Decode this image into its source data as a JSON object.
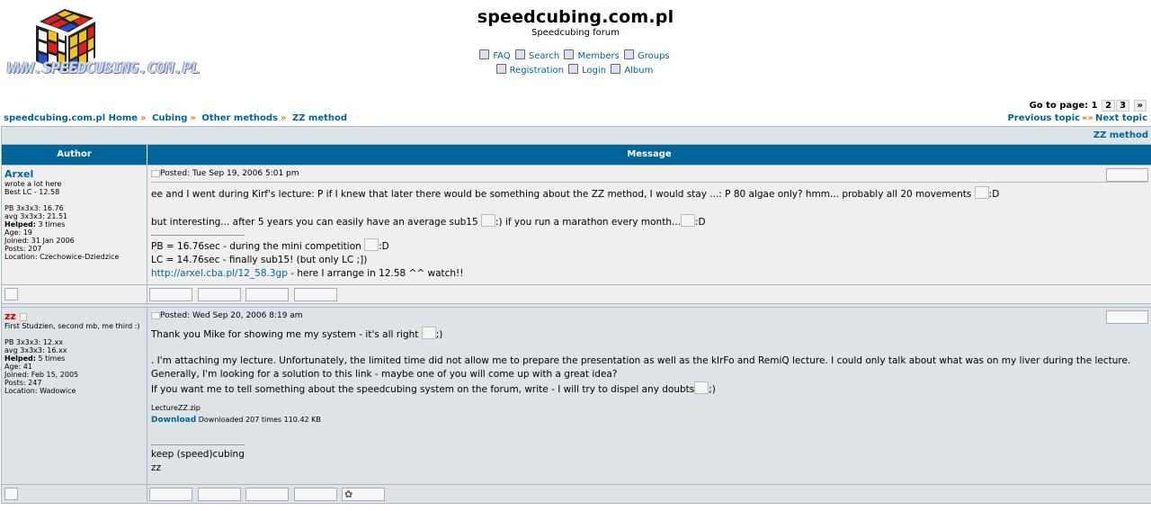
{
  "site": {
    "title": "speedcubing.com.pl",
    "subtitle": "Speedcubing forum",
    "logo_text": "WWW.SPEEDCUBING.COM.PL"
  },
  "nav": {
    "faq": "FAQ",
    "search": "Search",
    "members": "Members",
    "groups": "Groups",
    "registration": "Registration",
    "login": "Login",
    "album": "Album"
  },
  "pager": {
    "label": "Go to page:",
    "current": "1",
    "pages": [
      "2",
      "3"
    ],
    "next": "»"
  },
  "breadcrumb": {
    "home": "speedcubing.com.pl Home",
    "sep": "»",
    "cat": "Cubing",
    "forum": "Other methods",
    "topic": "ZZ method"
  },
  "topic_nav": {
    "prev": "Previous topic",
    "sep": "«»",
    "next": "Next topic"
  },
  "table": {
    "title": "ZZ method",
    "col_author": "Author",
    "col_message": "Message"
  },
  "posts": [
    {
      "author": "Arxel",
      "rank": "wrote a lot here",
      "info1": "Best LC - 12.58",
      "pb": "PB 3x3x3: 16.76",
      "avg": "avg 3x3x3: 21.51",
      "helped_label": "Helped:",
      "helped": "3 times",
      "age": "Age: 19",
      "joined": "Joined: 31 Jan 2006",
      "posts": "Posts: 207",
      "location": "Location: Czechowice-Dziedzice",
      "posted": "Posted: Tue Sep 19, 2006 5:01 pm",
      "line1": "ee and I went during Kirf's lecture: P if I knew that later there would be something about the ZZ method, I would stay ...: P 80 algae only? hmm... probably all 20 movements",
      "smiley1": ":D",
      "line2a": "but interesting... after 5 years you can easily have an average sub15",
      "smiley2": ":)",
      "line2b": "if you run a marathon every month...",
      "smiley3": ":D",
      "sig1": "PB = 16.76sec - during the mini competition",
      "smiley4": ":D",
      "sig2": "LC = 14.76sec - finally sub15! (but only LC ;])",
      "sig3_link": "http://arxel.cba.pl/12_58.3gp",
      "sig3_text": "- here I arrange in 12.58 ^^ watch!!"
    },
    {
      "author": "zz",
      "rank": "First Studzien, second mb, me third :)",
      "pb": "PB 3x3x3: 12.xx",
      "avg": "avg 3x3x3: 16.xx",
      "helped_label": "Helped:",
      "helped": "5 times",
      "age": "Age: 41",
      "joined": "Joined: Feb 15, 2005",
      "posts": "Posts: 247",
      "location": "Location: Wadowice",
      "posted": "Posted: Wed Sep 20, 2006 8:19 am",
      "line1": "Thank you Mike for showing me my system - it's all right",
      "smiley1": ";)",
      "line2": ". I'm attaching my lecture. Unfortunately, the limited time did not allow me to prepare the presentation as well as the kIrFo and RemiQ lecture. I could only talk about what was on my liver during the lecture.",
      "line3": "Generally, I'm looking for a solution to this link - maybe one of you will come up with a great idea?",
      "line4": "If you want me to tell something about the speedcubing system on the forum, write - I will try to dispel any doubts",
      "smiley2": ";)",
      "attach_name": "LectureZZ.zip",
      "attach_dl": "Download",
      "attach_info": "Downloaded 207 times 110.42 KB",
      "sig1": "keep (speed)cubing",
      "sig2": "zz"
    }
  ]
}
